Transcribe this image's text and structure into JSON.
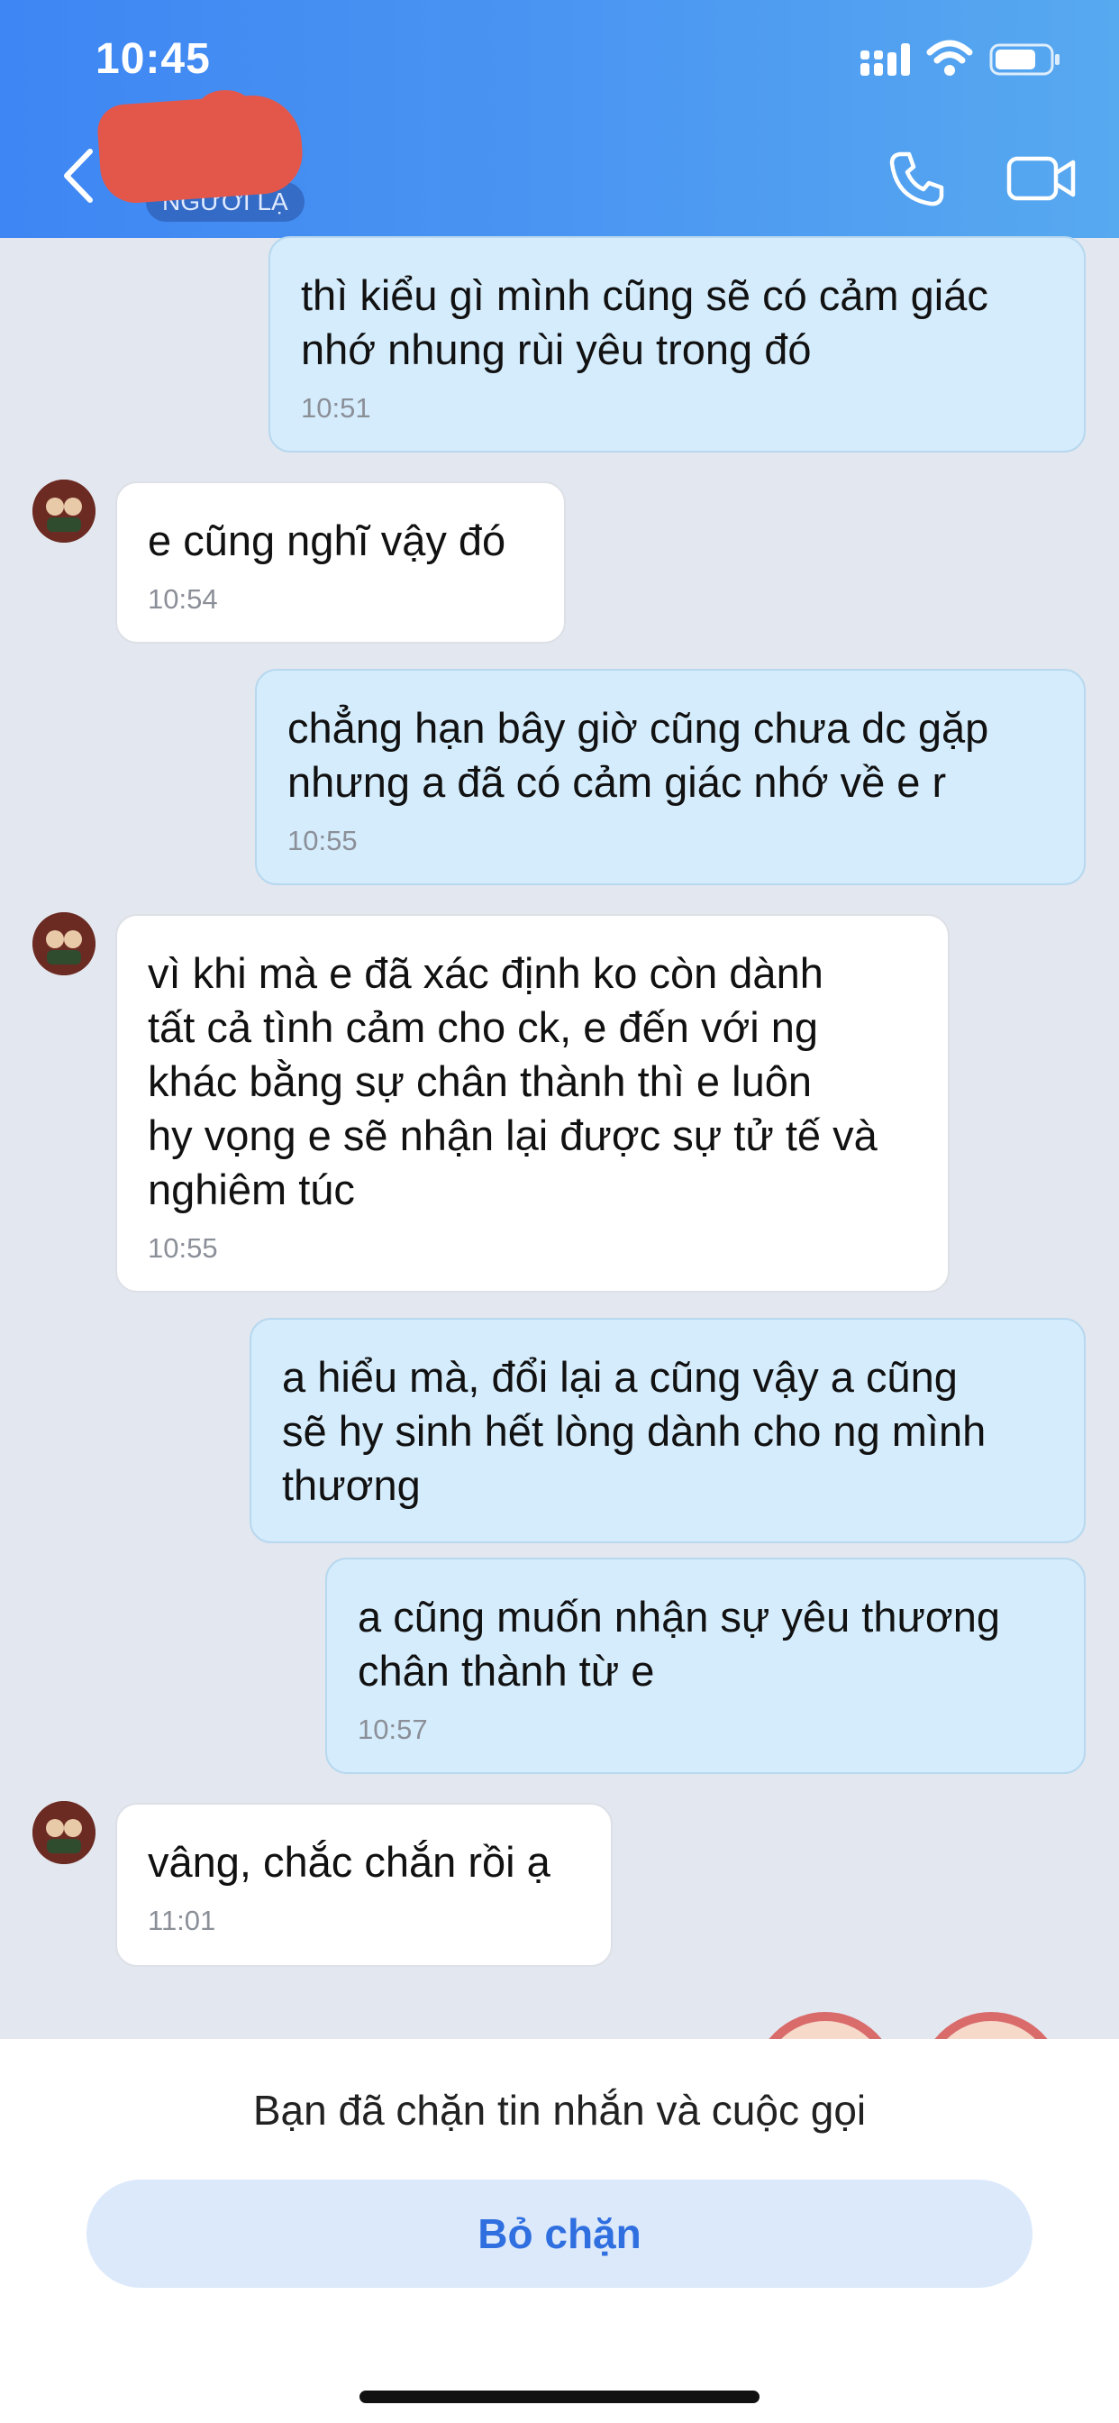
{
  "status_bar": {
    "time": "10:45"
  },
  "header": {
    "contact_tag": "NGƯỜI LẠ",
    "icons": [
      "back-icon",
      "phone-icon",
      "video-camera-icon"
    ],
    "accent_color": "#4a95f2"
  },
  "messages": [
    {
      "direction": "outgoing",
      "text": "thì kiểu gì mình cũng sẽ có cảm giác\nnhớ nhung rùi yêu trong đó",
      "time": "10:51"
    },
    {
      "direction": "incoming",
      "text": "e cũng nghĩ vậy đó",
      "time": "10:54"
    },
    {
      "direction": "outgoing",
      "text": "chẳng hạn bây giờ cũng chưa dc gặp\nnhưng a đã có cảm giác nhớ về e r",
      "time": "10:55"
    },
    {
      "direction": "incoming",
      "text": "vì khi mà e đã xác định ko còn dành\ntất cả tình cảm cho ck, e đến với ng\nkhác bằng sự chân thành thì e luôn\nhy vọng e sẽ nhận lại được sự tử tế và\nnghiêm túc",
      "time": "10:55"
    },
    {
      "direction": "outgoing",
      "text": "a hiểu mà, đổi lại a cũng vậy a cũng\nsẽ hy sinh hết lòng dành cho ng mình\nthương",
      "time": ""
    },
    {
      "direction": "outgoing",
      "text": "a cũng muốn nhận sự yêu thương\nchân thành từ e",
      "time": "10:57"
    },
    {
      "direction": "incoming",
      "text": "vâng, chắc chắn rồi ạ",
      "time": "11:01"
    }
  ],
  "footer": {
    "blocked_notice": "Bạn đã chặn tin nhắn và cuộc gọi",
    "unblock_label": "Bỏ chặn"
  }
}
